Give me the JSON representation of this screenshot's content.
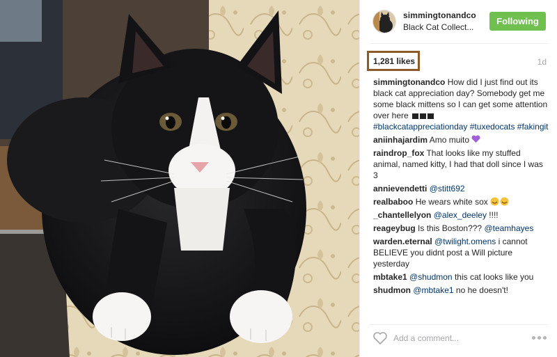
{
  "post": {
    "image": {
      "subject": "black and white kitten lying on a floral upholstered chair"
    },
    "owner": {
      "username": "simmingtonandco",
      "location": "Black Cat Collect..."
    },
    "follow_button": {
      "label": "Following",
      "color": "#70c050"
    },
    "likes": "1,281 likes",
    "time_ago": "1d",
    "caption": {
      "user": "simmingtonandco",
      "text": "How did I just find out its black cat appreciation day? Somebody get me some black mittens so I can get some attention over here",
      "hashtags": "#blackcatappreciationday #tuxedocats #fakingit"
    },
    "comments": [
      {
        "user": "aniinhajardim",
        "text": "Amo muito",
        "emoji": "purple-heart"
      },
      {
        "user": "raindrop_fox",
        "text": "That looks like my stuffed animal, named kitty, I had that doll since I was 3"
      },
      {
        "user": "annievendetti",
        "mention": "@stitt692",
        "text": ""
      },
      {
        "user": "realbaboo",
        "text": "He wears white sox",
        "emoji": "grinning-faces"
      },
      {
        "user": "_chantellelyon",
        "mention": "@alex_deeley",
        "text": "!!!!"
      },
      {
        "user": "reageybug",
        "text": "Is this Boston???",
        "mention": "@teamhayes"
      },
      {
        "user": "warden.eternal",
        "mention": "@twilight.omens",
        "text": "i cannot BELIEVE you didnt post a Will picture yesterday"
      },
      {
        "user": "mbtake1",
        "mention": "@shudmon",
        "text": "this cat looks like you"
      },
      {
        "user": "shudmon",
        "mention": "@mbtake1",
        "text": "no he doesn't!"
      }
    ],
    "add_comment": {
      "placeholder": "Add a comment..."
    },
    "icons": {
      "like": "heart-outline-icon",
      "more": "more-options-icon"
    },
    "colors": {
      "link": "#003569",
      "highlight_border": "#8a5a2b"
    }
  }
}
